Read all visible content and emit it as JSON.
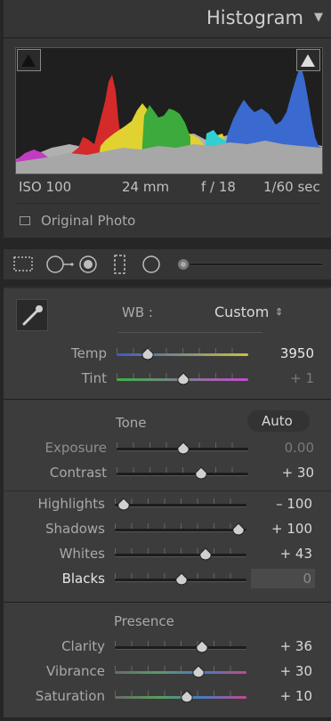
{
  "histogram": {
    "title": "Histogram",
    "iso": "ISO 100",
    "focal": "24 mm",
    "aperture": "f / 18",
    "shutter": "1/60 sec",
    "original_photo": "Original Photo"
  },
  "toolstrip": {
    "icons": [
      "crop-icon",
      "spot-removal-icon",
      "red-eye-icon",
      "graduated-filter-icon",
      "radial-filter-icon",
      "adjustment-brush-icon"
    ]
  },
  "wb": {
    "label": "WB :",
    "value": "Custom",
    "chevron": "⇕"
  },
  "basic": {
    "temp": {
      "label": "Temp",
      "value": "3950",
      "pos": 0.22
    },
    "tint": {
      "label": "Tint",
      "value": "+ 1",
      "pos": 0.5
    },
    "tone_label": "Tone",
    "auto_label": "Auto",
    "exposure": {
      "label": "Exposure",
      "value": "0.00",
      "pos": 0.5
    },
    "contrast": {
      "label": "Contrast",
      "value": "+ 30",
      "pos": 0.64
    },
    "highlights": {
      "label": "Highlights",
      "value": "– 100",
      "pos": 0.05
    },
    "shadows": {
      "label": "Shadows",
      "value": "+ 100",
      "pos": 0.96
    },
    "whites": {
      "label": "Whites",
      "value": "+ 43",
      "pos": 0.69
    },
    "blacks": {
      "label": "Blacks",
      "value": "0",
      "pos": 0.5
    },
    "presence_label": "Presence",
    "clarity": {
      "label": "Clarity",
      "value": "+ 36",
      "pos": 0.67
    },
    "vibrance": {
      "label": "Vibrance",
      "value": "+ 30",
      "pos": 0.64
    },
    "saturation": {
      "label": "Saturation",
      "value": "+ 10",
      "pos": 0.55
    }
  },
  "colors": {
    "panel": "#3c3c3c",
    "dark": "#262626",
    "temp_gradient": [
      "#3b5bc4",
      "#c8c040"
    ],
    "tint_gradient": [
      "#3fb04a",
      "#c04ad0"
    ]
  }
}
